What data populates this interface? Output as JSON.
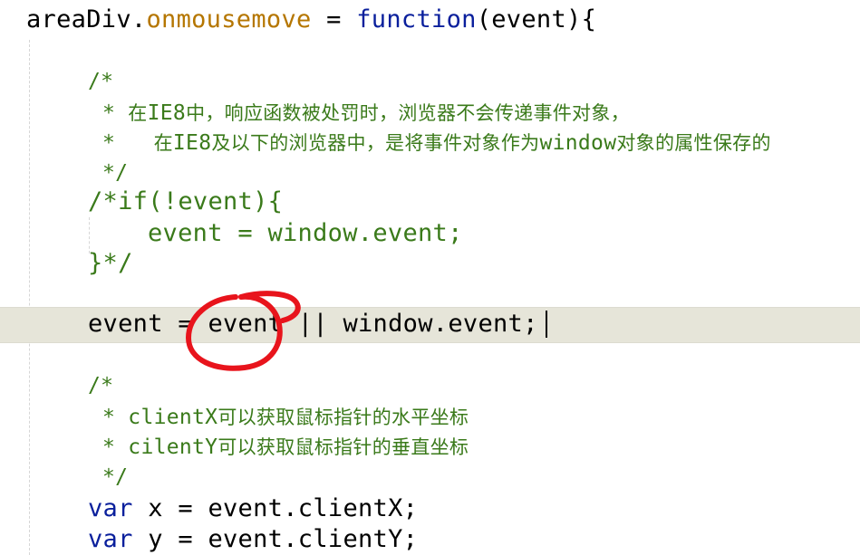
{
  "colors": {
    "identifier": "#000000",
    "property": "#b57600",
    "keyword": "#0a1f9c",
    "comment": "#3a7a1a",
    "current_line": "#e6e5d9",
    "annotation": "#e8141c"
  },
  "code": {
    "l1": {
      "obj": "areaDiv",
      "dot": ".",
      "prop": "onmousemove",
      "eq": " = ",
      "kw": "function",
      "rest": "(event){"
    },
    "c1_open": "/*",
    "c1_star1": "* ",
    "c1_text1_a": "在",
    "c1_text1_b": "IE8",
    "c1_text1_c": "中，响应函数被处罚时，浏览器不会传递事件对象，",
    "c1_star2": "*   ",
    "c1_text2_a": "在",
    "c1_text2_b": "IE8",
    "c1_text2_c": "及以下的浏览器中，是将事件对象作为",
    "c1_text2_d": "window",
    "c1_text2_e": "对象的属性保存的",
    "c1_close": "*/",
    "c2_l1": "/*if(!event){",
    "c2_l2": "event = window.event;",
    "c2_l3": "}*/",
    "assign": "event = event || window.event;",
    "c3_open": "/*",
    "c3_star1": "* ",
    "c3_text1_a": "clientX",
    "c3_text1_b": "可以获取鼠标指针的水平坐标",
    "c3_star2": "* ",
    "c3_text2_a": "cilentY",
    "c3_text2_b": "可以获取鼠标指针的垂直坐标",
    "c3_close": "*/",
    "vx_kw": "var",
    "vx_rest": " x = event.clientX;",
    "vy_kw": "var",
    "vy_rest": " y = event.clientY;"
  }
}
